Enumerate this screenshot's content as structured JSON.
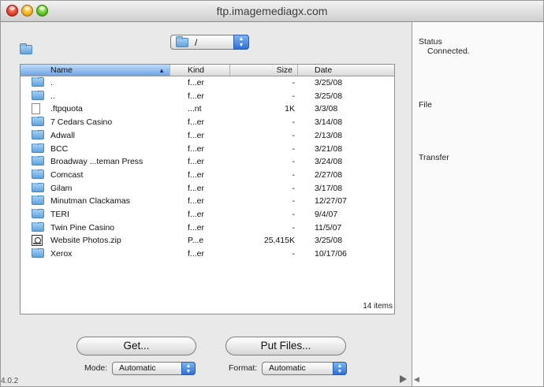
{
  "window": {
    "title": "ftp.imagemediagx.com"
  },
  "toolbar": {
    "path_value": "/"
  },
  "table": {
    "columns": [
      "Name",
      "Kind",
      "Size",
      "Date"
    ],
    "rows": [
      {
        "icon": "folder",
        "name": ".",
        "kind": "f...er",
        "size": "-",
        "date": "3/25/08"
      },
      {
        "icon": "folder",
        "name": "..",
        "kind": "f...er",
        "size": "-",
        "date": "3/25/08"
      },
      {
        "icon": "document",
        "name": ".ftpquota",
        "kind": "...nt",
        "size": "1K",
        "date": "3/3/08"
      },
      {
        "icon": "folder",
        "name": "7 Cedars Casino",
        "kind": "f...er",
        "size": "-",
        "date": "3/14/08"
      },
      {
        "icon": "folder",
        "name": "Adwall",
        "kind": "f...er",
        "size": "-",
        "date": "2/13/08"
      },
      {
        "icon": "folder",
        "name": "BCC",
        "kind": "f...er",
        "size": "-",
        "date": "3/21/08"
      },
      {
        "icon": "folder",
        "name": "Broadway ...teman Press",
        "kind": "f...er",
        "size": "-",
        "date": "3/24/08"
      },
      {
        "icon": "folder",
        "name": "Comcast",
        "kind": "f...er",
        "size": "-",
        "date": "2/27/08"
      },
      {
        "icon": "folder",
        "name": "Gilam",
        "kind": "f...er",
        "size": "-",
        "date": "3/17/08"
      },
      {
        "icon": "folder",
        "name": "Minutman Clackamas",
        "kind": "f...er",
        "size": "-",
        "date": "12/27/07"
      },
      {
        "icon": "folder",
        "name": "TERI",
        "kind": "f...er",
        "size": "-",
        "date": "9/4/07"
      },
      {
        "icon": "folder",
        "name": "Twin Pine Casino",
        "kind": "f...er",
        "size": "-",
        "date": "11/5/07"
      },
      {
        "icon": "zip",
        "name": "Website Photos.zip",
        "kind": "P...e",
        "size": "25,415K",
        "date": "3/25/08"
      },
      {
        "icon": "folder",
        "name": "Xerox",
        "kind": "f...er",
        "size": "-",
        "date": "10/17/06"
      }
    ],
    "item_count": "14 items"
  },
  "buttons": {
    "get": "Get...",
    "put": "Put Files..."
  },
  "options": {
    "mode_label": "Mode:",
    "mode_value": "Automatic",
    "format_label": "Format:",
    "format_value": "Automatic"
  },
  "footer": {
    "version": "4.0.2"
  },
  "drawer": {
    "status_label": "Status",
    "status_value": "Connected.",
    "file_label": "File",
    "transfer_label": "Transfer"
  },
  "colors": {
    "header_selected": "#6da4e6",
    "folder": "#5fa2dd",
    "stepper": "#2f6fd6"
  }
}
